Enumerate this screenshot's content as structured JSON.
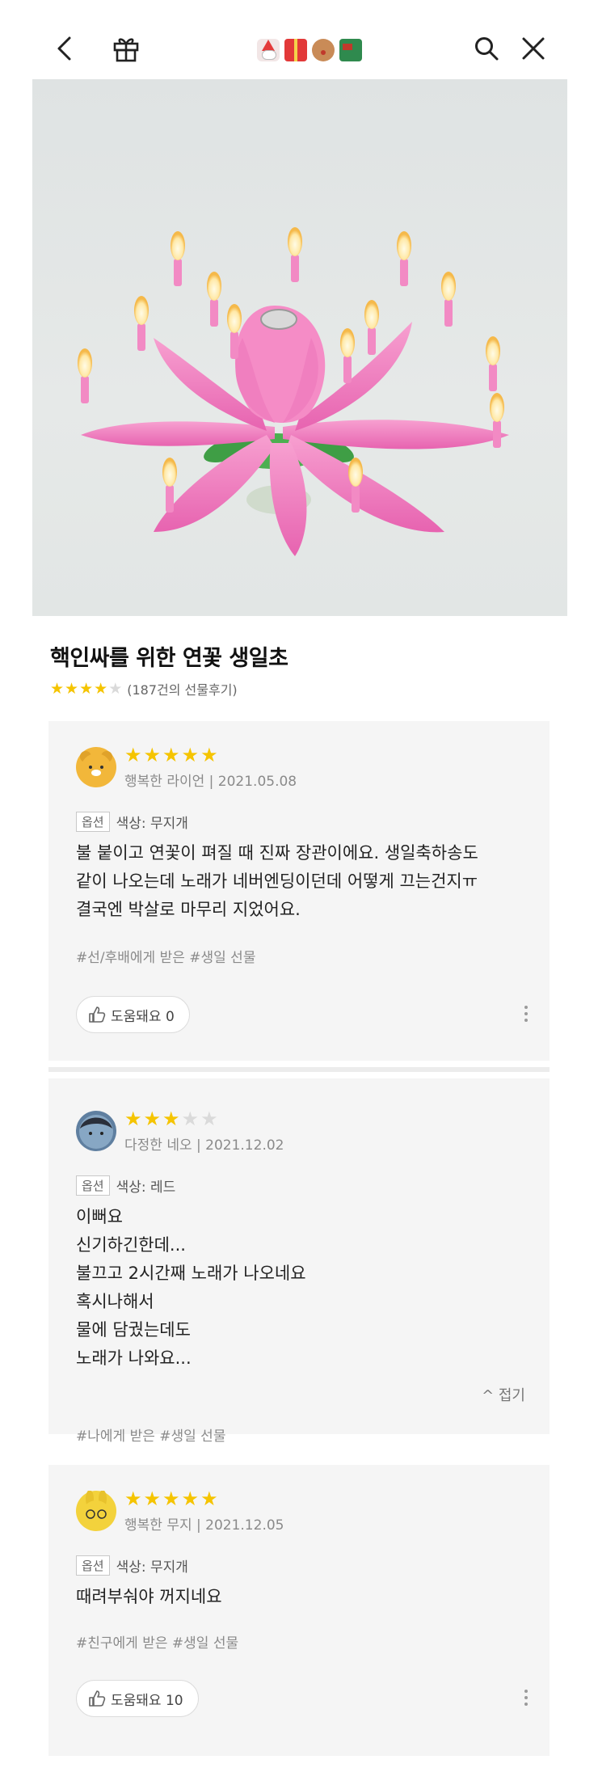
{
  "header": {
    "icons": [
      "back-arrow-icon",
      "gift-icon",
      "christmas-emoji-strip",
      "search-icon",
      "close-icon"
    ]
  },
  "product": {
    "title": "핵인싸를 위한 연꽃 생일초",
    "rating_stars": 4,
    "review_count": "(187건의 선물후기)"
  },
  "reviews": [
    {
      "stars": 5,
      "author": "행복한 라이언 | 2021.05.08",
      "option_tag": "옵션",
      "option_value": "색상: 무지개",
      "lines": [
        "불 붙이고 연꽃이 펴질 때 진짜 장관이에요. 생일축하송도",
        "같이 나오는데 노래가 네버엔딩이던데 어떻게 끄는건지ㅠ",
        "결국엔 박살로 마무리 지었어요."
      ],
      "tags": "#선/후배에게 받은 #생일 선물",
      "helpful": "도움돼요 0"
    },
    {
      "stars": 3,
      "author": "다정한 네오 | 2021.12.02",
      "option_tag": "옵션",
      "option_value": "색상: 레드",
      "lines": [
        "이뻐요",
        "신기하긴한데...",
        "불끄고 2시간째 노래가 나오네요",
        "혹시나해서",
        "물에 담궜는데도",
        "노래가 나와요..."
      ],
      "fold": "^ 접기",
      "tags": "#나에게 받은 #생일 선물"
    },
    {
      "stars": 5,
      "author": "행복한 무지 | 2021.12.05",
      "option_tag": "옵션",
      "option_value": "색상: 무지개",
      "lines": [
        "때려부숴야 꺼지네요"
      ],
      "tags": "#친구에게 받은 #생일 선물",
      "helpful": "도움돼요 10"
    }
  ],
  "colors": {
    "star": "#f5c400",
    "card_bg": "#f5f5f5",
    "lotus": "#f07fbf"
  }
}
